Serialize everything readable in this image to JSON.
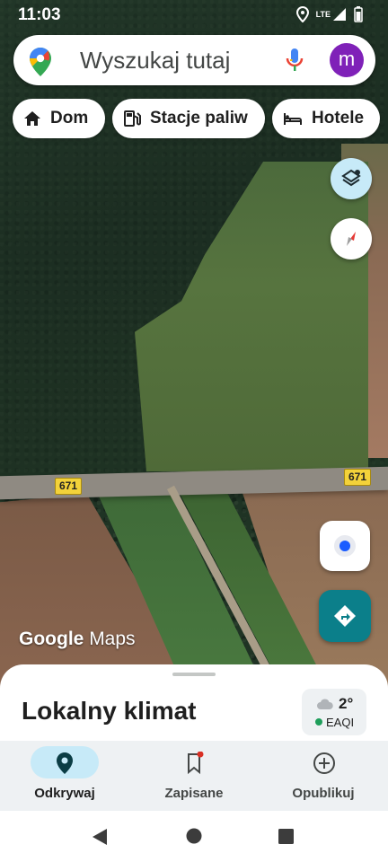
{
  "status_bar": {
    "time": "11:03",
    "network": "LTE"
  },
  "search": {
    "placeholder": "Wyszukaj tutaj",
    "avatar_letter": "m"
  },
  "chips": [
    {
      "label": "Dom",
      "icon": "home-icon"
    },
    {
      "label": "Stacje paliw",
      "icon": "gas-station-icon"
    },
    {
      "label": "Hotele",
      "icon": "bed-icon"
    }
  ],
  "map": {
    "road_labels": [
      "671",
      "671"
    ],
    "branding": {
      "google": "Google",
      "maps": "Maps"
    }
  },
  "buttons": {
    "layers": "layers-icon",
    "compass": "compass-icon",
    "my_location": "my-location-icon",
    "directions": "directions-icon"
  },
  "sheet": {
    "title": "Lokalny klimat",
    "weather": {
      "temp": "2°",
      "aqi_label": "EAQI",
      "icon": "cloud-icon"
    }
  },
  "nav": [
    {
      "label": "Odkrywaj",
      "icon": "explore-pin-icon",
      "active": true
    },
    {
      "label": "Zapisane",
      "icon": "bookmark-icon",
      "active": false
    },
    {
      "label": "Opublikuj",
      "icon": "add-circle-icon",
      "active": false
    }
  ],
  "colors": {
    "accent_teal": "#0b7f8a",
    "avatar_purple": "#7f21b8",
    "active_pill": "#c7eaf8",
    "road_shield": "#f3d23a"
  }
}
